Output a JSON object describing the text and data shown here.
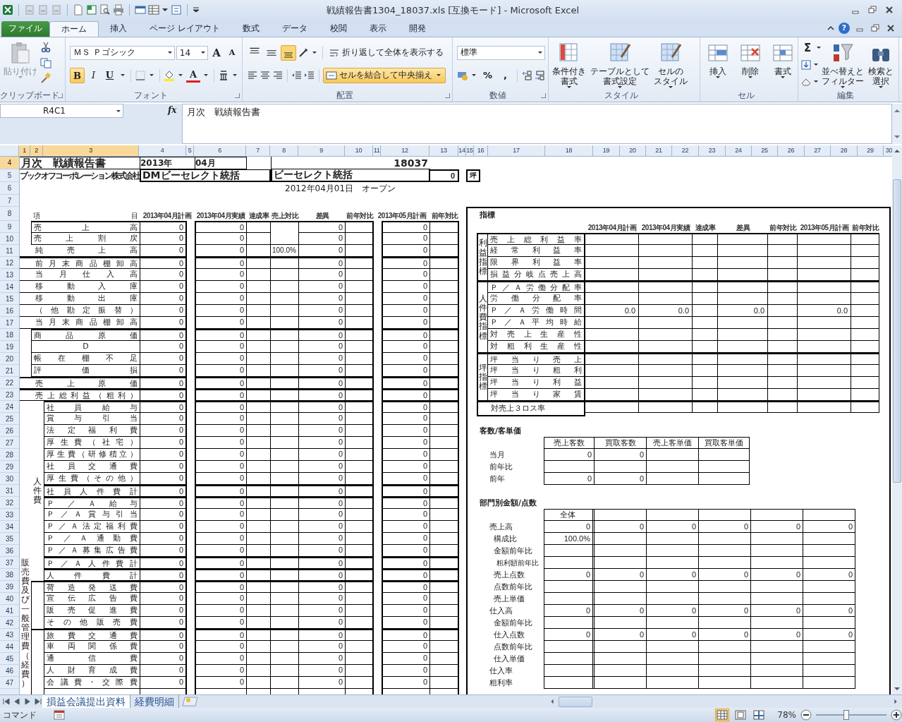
{
  "window": {
    "title": "戦績報告書1304_18037.xls  [互換モード]  -  Microsoft Excel"
  },
  "ribbon_tabs": [
    {
      "label": "ファイル",
      "kind": "file",
      "selected": false
    },
    {
      "label": "ホーム",
      "kind": "tab",
      "selected": true
    },
    {
      "label": "挿入",
      "kind": "tab",
      "selected": false
    },
    {
      "label": "ページ レイアウト",
      "kind": "tab",
      "selected": false
    },
    {
      "label": "数式",
      "kind": "tab",
      "selected": false
    },
    {
      "label": "データ",
      "kind": "tab",
      "selected": false
    },
    {
      "label": "校閲",
      "kind": "tab",
      "selected": false
    },
    {
      "label": "表示",
      "kind": "tab",
      "selected": false
    },
    {
      "label": "開発",
      "kind": "tab",
      "selected": false
    }
  ],
  "help": "?",
  "clipboard": {
    "paste": "貼り付け",
    "paste_disabled": true,
    "label": "クリップボード"
  },
  "font": {
    "name": "ＭＳ Ｐゴシック",
    "size": "14",
    "grow": "A",
    "shrink": "A",
    "color_button": "A",
    "label": "フォント",
    "styles": [
      {
        "label": "B",
        "kind": "bold",
        "selected": true
      },
      {
        "label": "I",
        "kind": "italic",
        "selected": false
      },
      {
        "label": "U",
        "kind": "underline",
        "selected": false
      }
    ]
  },
  "alignment": {
    "vertical": [
      {
        "kind": "top",
        "selected": false
      },
      {
        "kind": "middle",
        "selected": false
      },
      {
        "kind": "bottom",
        "selected": true
      }
    ],
    "wrap": "折り返して全体を表示する",
    "merge": "セルを結合して中央揃え",
    "merge_selected": true,
    "label": "配置"
  },
  "number": {
    "format": "標準",
    "symbols": [
      "%",
      ","
    ],
    "label": "数値"
  },
  "styles": {
    "buttons": [
      [
        "条件付き",
        "書式"
      ],
      [
        "テーブルとして",
        "書式設定"
      ],
      [
        "セルの",
        "スタイル"
      ]
    ],
    "label": "スタイル"
  },
  "cells": {
    "buttons": [
      "挿入",
      "削除",
      "書式"
    ],
    "label": "セル"
  },
  "editing": {
    "sum": "Σ",
    "buttons": [
      [
        "並べ替えと",
        "フィルター"
      ],
      [
        "検索と",
        "選択"
      ]
    ],
    "label": "編集"
  },
  "formula_bar": {
    "name_box": "R4C1",
    "fx": "fx",
    "content": "月次　戦績報告書"
  },
  "columns": [
    {
      "label": "1",
      "selected": true
    },
    {
      "label": "2",
      "selected": true
    },
    {
      "label": "3",
      "selected": true
    },
    {
      "label": "4",
      "selected": false
    },
    {
      "label": "5",
      "selected": false
    },
    {
      "label": "6",
      "selected": false
    },
    {
      "label": "7",
      "selected": false
    },
    {
      "label": "8",
      "selected": false
    },
    {
      "label": "9",
      "selected": false
    },
    {
      "label": "10",
      "selected": false
    },
    {
      "label": "11",
      "selected": false
    },
    {
      "label": "12",
      "selected": false
    },
    {
      "label": "13",
      "selected": false
    },
    {
      "label": "14",
      "selected": false
    },
    {
      "label": "15",
      "selected": false
    },
    {
      "label": "16",
      "selected": false
    },
    {
      "label": "17",
      "selected": false
    },
    {
      "label": "18",
      "selected": false
    },
    {
      "label": "19",
      "selected": false
    },
    {
      "label": "20",
      "selected": false
    },
    {
      "label": "21",
      "selected": false
    },
    {
      "label": "22",
      "selected": false
    },
    {
      "label": "23",
      "selected": false
    },
    {
      "label": "24",
      "selected": false
    },
    {
      "label": "25",
      "selected": false
    },
    {
      "label": "26",
      "selected": false
    },
    {
      "label": "27",
      "selected": false
    },
    {
      "label": "28",
      "selected": false
    },
    {
      "label": "29",
      "selected": false
    },
    {
      "label": "30",
      "selected": false
    }
  ],
  "rows": [
    {
      "label": "4",
      "selected": true
    },
    {
      "label": "5",
      "selected": false
    },
    {
      "label": "6",
      "selected": false
    },
    {
      "label": "7",
      "selected": false
    },
    {
      "label": "8",
      "selected": false
    },
    {
      "label": "9",
      "selected": false
    },
    {
      "label": "10",
      "selected": false
    },
    {
      "label": "11",
      "selected": false
    },
    {
      "label": "12",
      "selected": false
    },
    {
      "label": "13",
      "selected": false
    },
    {
      "label": "14",
      "selected": false
    },
    {
      "label": "15",
      "selected": false
    },
    {
      "label": "16",
      "selected": false
    },
    {
      "label": "17",
      "selected": false
    },
    {
      "label": "18",
      "selected": false
    },
    {
      "label": "19",
      "selected": false
    },
    {
      "label": "20",
      "selected": false
    },
    {
      "label": "21",
      "selected": false
    },
    {
      "label": "22",
      "selected": false
    },
    {
      "label": "23",
      "selected": false
    },
    {
      "label": "24",
      "selected": false
    },
    {
      "label": "25",
      "selected": false
    },
    {
      "label": "26",
      "selected": false
    },
    {
      "label": "27",
      "selected": false
    },
    {
      "label": "28",
      "selected": false
    },
    {
      "label": "29",
      "selected": false
    },
    {
      "label": "30",
      "selected": false
    },
    {
      "label": "31",
      "selected": false
    },
    {
      "label": "32",
      "selected": false
    },
    {
      "label": "33",
      "selected": false
    },
    {
      "label": "34",
      "selected": false
    },
    {
      "label": "35",
      "selected": false
    },
    {
      "label": "36",
      "selected": false
    },
    {
      "label": "37",
      "selected": false
    },
    {
      "label": "38",
      "selected": false
    },
    {
      "label": "39",
      "selected": false
    },
    {
      "label": "40",
      "selected": false
    },
    {
      "label": "41",
      "selected": false
    },
    {
      "label": "42",
      "selected": false
    },
    {
      "label": "43",
      "selected": false
    },
    {
      "label": "44",
      "selected": false
    },
    {
      "label": "45",
      "selected": false
    },
    {
      "label": "46",
      "selected": false
    },
    {
      "label": "47",
      "selected": false
    }
  ],
  "report_header": {
    "title": "月次　戦績報告書",
    "year": "2013年",
    "month": "04月",
    "company": "ブックオフコーポレーション株式会社",
    "division": "DMビーセレクト統括",
    "code": "18037",
    "store": "ビーセレクト統括",
    "area": "0",
    "area_unit": "坪",
    "open_date": "2012年04月01日　オープン"
  },
  "pl_table": {
    "head_left": "項",
    "head_right": "目",
    "columns": [
      "2013年04月計画",
      "2013年04月実績",
      "達成率",
      "売上対比",
      "差異",
      "前年対比",
      "2013年05月計画",
      "前年対比"
    ],
    "rows": [
      {
        "label": "売上高",
        "kind": "sub",
        "thick": true,
        "plan": "0",
        "actual": "0",
        "diff": "0",
        "next_plan": "0"
      },
      {
        "label": "売上割戻",
        "kind": "sub",
        "thick": false,
        "plan": "0",
        "actual": "0",
        "diff": "0",
        "next_plan": "0"
      },
      {
        "label": "純売上高",
        "kind": "main",
        "thick": false,
        "plan": "0",
        "actual": "0",
        "sales_ratio": "100.0%",
        "diff": "0",
        "next_plan": "0"
      },
      {
        "label": "前月末商品棚卸高",
        "kind": "main",
        "thick": true,
        "plan": "0",
        "actual": "0",
        "diff": "0",
        "next_plan": "0"
      },
      {
        "label": "当月仕入高",
        "kind": "main",
        "thick": false,
        "plan": "0",
        "actual": "0",
        "diff": "0",
        "next_plan": "0"
      },
      {
        "label": "移動入庫",
        "kind": "main",
        "thick": false,
        "plan": "0",
        "actual": "0",
        "diff": "0",
        "next_plan": "0"
      },
      {
        "label": "移動出庫",
        "kind": "main",
        "thick": false,
        "plan": "0",
        "actual": "0",
        "diff": "0",
        "next_plan": "0"
      },
      {
        "label": "（他勘定振替）",
        "kind": "main",
        "thick": false,
        "plan": "0",
        "actual": "0",
        "diff": "0",
        "next_plan": "0"
      },
      {
        "label": "当月末商品棚卸高",
        "kind": "main",
        "thick": false,
        "plan": "0",
        "actual": "0",
        "diff": "0",
        "next_plan": "0"
      },
      {
        "label": "商品原価",
        "kind": "sub",
        "thick": true,
        "plan": "0",
        "actual": "0",
        "diff": "0",
        "next_plan": "0"
      },
      {
        "label": "D",
        "kind": "sub",
        "thick": false,
        "plan": "0",
        "actual": "0",
        "diff": "0",
        "next_plan": "0"
      },
      {
        "label": "帳在棚不足",
        "kind": "sub",
        "thick": false,
        "plan": "0",
        "actual": "0",
        "diff": "0",
        "next_plan": "0"
      },
      {
        "label": "評価損",
        "kind": "sub",
        "thick": false,
        "plan": "0",
        "actual": "0",
        "diff": "0",
        "next_plan": "0"
      },
      {
        "label": "売上原価",
        "kind": "main",
        "thick": true,
        "plan": "0",
        "actual": "0",
        "diff": "0",
        "next_plan": "0"
      },
      {
        "label": "売上総利益（粗利）",
        "kind": "main",
        "thick": true,
        "plan": "0",
        "actual": "0",
        "diff": "0",
        "next_plan": "0"
      },
      {
        "label": "社員給与",
        "kind": "staff",
        "thick": true,
        "plan": "0",
        "actual": "0",
        "diff": "0",
        "next_plan": "0"
      },
      {
        "label": "賞与引当",
        "kind": "staff",
        "thick": false,
        "plan": "0",
        "actual": "0",
        "diff": "0",
        "next_plan": "0"
      },
      {
        "label": "法定福利費",
        "kind": "staff",
        "thick": false,
        "plan": "0",
        "actual": "0",
        "diff": "0",
        "next_plan": "0"
      },
      {
        "label": "厚生費（社宅）",
        "kind": "staff",
        "thick": false,
        "plan": "0",
        "actual": "0",
        "diff": "0",
        "next_plan": "0"
      },
      {
        "label": "厚生費（研修積立）",
        "kind": "staff",
        "thick": false,
        "plan": "0",
        "actual": "0",
        "diff": "0",
        "next_plan": "0"
      },
      {
        "label": "社員交通費",
        "kind": "staff",
        "thick": false,
        "plan": "0",
        "actual": "0",
        "diff": "0",
        "next_plan": "0"
      },
      {
        "label": "厚生費（その他）",
        "kind": "staff",
        "thick": false,
        "plan": "0",
        "actual": "0",
        "diff": "0",
        "next_plan": "0"
      },
      {
        "label": "社員人件費計",
        "kind": "staff",
        "thick": true,
        "plan": "0",
        "actual": "0",
        "diff": "0",
        "next_plan": "0"
      },
      {
        "label": "Ｐ／Ａ給与",
        "kind": "staff",
        "thick": true,
        "plan": "0",
        "actual": "0",
        "diff": "0",
        "next_plan": "0"
      },
      {
        "label": "Ｐ／Ａ賞与引当",
        "kind": "staff",
        "thick": false,
        "plan": "0",
        "actual": "0",
        "diff": "0",
        "next_plan": "0"
      },
      {
        "label": "Ｐ／Ａ法定福利費",
        "kind": "staff",
        "thick": false,
        "plan": "0",
        "actual": "0",
        "diff": "0",
        "next_plan": "0"
      },
      {
        "label": "Ｐ／Ａ通勤費",
        "kind": "staff",
        "thick": false,
        "plan": "0",
        "actual": "0",
        "diff": "0",
        "next_plan": "0"
      },
      {
        "label": "Ｐ／Ａ募集広告費",
        "kind": "staff",
        "thick": false,
        "plan": "0",
        "actual": "0",
        "diff": "0",
        "next_plan": "0"
      },
      {
        "label": "Ｐ／Ａ人件費計",
        "kind": "staff",
        "thick": true,
        "plan": "0",
        "actual": "0",
        "diff": "0",
        "next_plan": "0"
      },
      {
        "label": "人件費計",
        "kind": "staff",
        "thick": true,
        "plan": "0",
        "actual": "0",
        "diff": "0",
        "next_plan": "0"
      },
      {
        "label": "荷造発送費",
        "kind": "staff",
        "thick": true,
        "plan": "0",
        "actual": "0",
        "diff": "0",
        "next_plan": "0"
      },
      {
        "label": "宣伝広告費",
        "kind": "staff",
        "thick": false,
        "plan": "0",
        "actual": "0",
        "diff": "0",
        "next_plan": "0"
      },
      {
        "label": "販売促進費",
        "kind": "staff",
        "thick": false,
        "plan": "0",
        "actual": "0",
        "diff": "0",
        "next_plan": "0"
      },
      {
        "label": "その他販売費",
        "kind": "staff",
        "thick": false,
        "plan": "0",
        "actual": "0",
        "diff": "0",
        "next_plan": "0"
      },
      {
        "label": "旅費交通費",
        "kind": "staff",
        "thick": true,
        "plan": "0",
        "actual": "0",
        "diff": "0",
        "next_plan": "0"
      },
      {
        "label": "車両関係費",
        "kind": "staff",
        "thick": false,
        "plan": "0",
        "actual": "0",
        "diff": "0",
        "next_plan": "0"
      },
      {
        "label": "通信費",
        "kind": "staff",
        "thick": false,
        "plan": "0",
        "actual": "0",
        "diff": "0",
        "next_plan": "0"
      },
      {
        "label": "人財育成費",
        "kind": "staff",
        "thick": false,
        "plan": "0",
        "actual": "0",
        "diff": "0",
        "next_plan": "0"
      },
      {
        "label": "会議費・交際費",
        "kind": "staff",
        "thick": false,
        "plan": "0",
        "actual": "0",
        "diff": "0",
        "next_plan": "0"
      }
    ]
  },
  "pl_groups": [
    {
      "label": "人件費",
      "kind": "staff"
    },
    {
      "label": "販売費及び一般管理費（経費）",
      "kind": "sga"
    }
  ],
  "indicators": {
    "title": "指標",
    "columns": [
      "2013年04月計画",
      "2013年04月実績",
      "達成率",
      "差異",
      "前年対比",
      "2013年05月計画",
      "前年対比"
    ],
    "groups": [
      {
        "label": "利益指標",
        "rows": [
          {
            "label": "売上総利益率"
          },
          {
            "label": "経常利益率"
          },
          {
            "label": "限界利益率"
          },
          {
            "label": "損益分岐点売上高"
          }
        ]
      },
      {
        "label": "人件費指標",
        "rows": [
          {
            "label": "Ｐ／Ａ労働分配率"
          },
          {
            "label": "労働分配率"
          },
          {
            "label": "Ｐ／Ａ労働時間",
            "plan": "0.0",
            "actual": "0.0",
            "diff": "0.0",
            "next_plan": "0.0"
          },
          {
            "label": "Ｐ／Ａ平均時給"
          },
          {
            "label": "対売上生産性"
          },
          {
            "label": "対粗利生産性"
          }
        ]
      },
      {
        "label": "坪指標",
        "rows": [
          {
            "label": "坪当り売上"
          },
          {
            "label": "坪当り粗利"
          },
          {
            "label": "坪当り利益"
          },
          {
            "label": "坪当り家賃"
          }
        ]
      },
      {
        "rows": [
          {
            "label": "対売上３ロス率"
          }
        ]
      }
    ]
  },
  "customers": {
    "title": "客数/客単価",
    "columns": [
      "売上客数",
      "買取客数",
      "売上客単価",
      "買取客単価"
    ],
    "rows": [
      {
        "label": "当月",
        "values": [
          "0",
          "0"
        ]
      },
      {
        "label": "前年比",
        "values": []
      },
      {
        "label": "前年",
        "values": [
          "0",
          "0"
        ]
      }
    ]
  },
  "departments": {
    "title": "部門別金額/点数",
    "columns": [
      "全体"
    ],
    "rows": [
      {
        "label": "売上高",
        "kind": "main",
        "values": [
          "0",
          "0",
          "0",
          "0",
          "0",
          "0"
        ]
      },
      {
        "label": "構成比",
        "kind": "sub",
        "values": [
          "100.0%"
        ]
      },
      {
        "label": "金額前年比",
        "kind": "sub",
        "values": []
      },
      {
        "label": "粗利額前年比",
        "kind": "small",
        "values": []
      },
      {
        "label": "売上点数",
        "kind": "sub",
        "values": [
          "0",
          "0",
          "0",
          "0",
          "0",
          "0"
        ]
      },
      {
        "label": "点数前年比",
        "kind": "sub",
        "values": []
      },
      {
        "label": "売上単価",
        "kind": "sub",
        "values": []
      },
      {
        "label": "仕入高",
        "kind": "main",
        "values": [
          "0",
          "0",
          "0",
          "0",
          "0",
          "0"
        ]
      },
      {
        "label": "金額前年比",
        "kind": "sub",
        "values": []
      },
      {
        "label": "仕入点数",
        "kind": "sub",
        "values": [
          "0",
          "0",
          "0",
          "0",
          "0",
          "0"
        ]
      },
      {
        "label": "点数前年比",
        "kind": "sub",
        "values": []
      },
      {
        "label": "仕入単価",
        "kind": "sub",
        "values": []
      },
      {
        "label": "仕入率",
        "kind": "main",
        "values": []
      },
      {
        "label": "粗利率",
        "kind": "main",
        "values": []
      }
    ]
  },
  "sheet_tabs": [
    {
      "label": "損益会議提出資料",
      "selected": true
    },
    {
      "label": "経費明細",
      "selected": false
    }
  ],
  "status_bar": {
    "mode": "コマンド",
    "zoom": "78%",
    "zoom_slider": {
      "level": 0.43
    },
    "view_buttons": [
      {
        "kind": "normal",
        "selected": true
      },
      {
        "kind": "layout",
        "selected": false
      },
      {
        "kind": "pagebreak",
        "selected": false
      }
    ]
  }
}
